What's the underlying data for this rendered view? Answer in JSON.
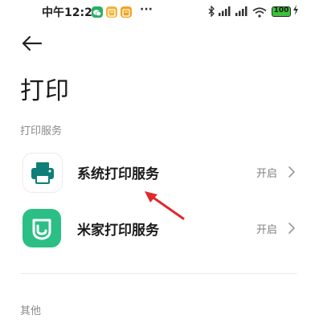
{
  "status_bar": {
    "time": "中午12:20",
    "more": "···",
    "battery_level": "100",
    "battery_color": "#3fbf3f",
    "icons": [
      "wechat-icon",
      "notes-icon",
      "notes-icon",
      "bluetooth-icon",
      "signal-icon",
      "signal-icon",
      "wifi-icon",
      "battery-icon",
      "charging-icon"
    ]
  },
  "header": {
    "back_icon": "back-arrow-icon",
    "title": "打印"
  },
  "sections": {
    "print_services": "打印服务",
    "other": "其他"
  },
  "services": [
    {
      "label": "系统打印服务",
      "status": "开启",
      "icon": "printer-icon",
      "icon_color": "#0d7f78"
    },
    {
      "label": "米家打印服务",
      "status": "开启",
      "icon": "mijia-icon",
      "icon_color": "#2bbf85"
    }
  ],
  "annotation": {
    "color": "#e0292c"
  }
}
